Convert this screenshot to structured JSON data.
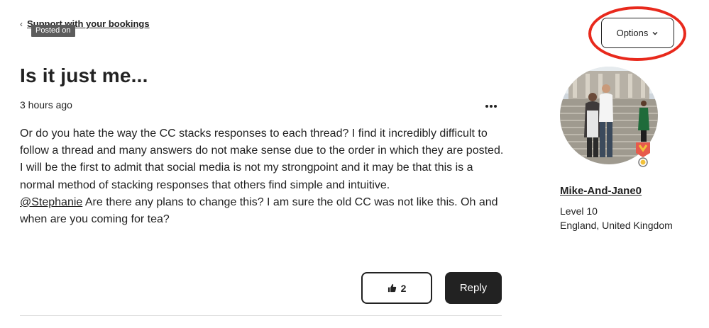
{
  "breadcrumb": {
    "link_label": "Support with your bookings"
  },
  "tooltip": {
    "text": "Posted on"
  },
  "header": {
    "options_label": "Options"
  },
  "post": {
    "title": "Is it just me...",
    "time": "3 hours ago",
    "paragraph_1": "Or do you hate the way the CC stacks responses to each thread? I find it incredibly difficult to follow a thread and many answers do not make sense due to the order in which they are posted.",
    "paragraph_2": "I will be the first to admit that social media is not my strongpoint and it may be that this is a normal method of stacking responses that others find simple and intuitive.",
    "mention": "@Stephanie",
    "paragraph_3_rest": " Are there any plans to change this? I am sure the old CC was not like this. Oh and when are you coming for tea?"
  },
  "actions": {
    "like_count": "2",
    "reply_label": "Reply"
  },
  "author": {
    "name": "Mike-And-Jane0",
    "level": "Level 10",
    "location": "England, United Kingdom"
  },
  "colors": {
    "annotation_ring": "#e8291c",
    "primary_button": "#222222",
    "text": "#222222"
  },
  "icons": [
    "chevron-left-icon",
    "chevron-down-icon",
    "more-dots-icon",
    "thumbs-up-icon",
    "level-badge-icon"
  ]
}
